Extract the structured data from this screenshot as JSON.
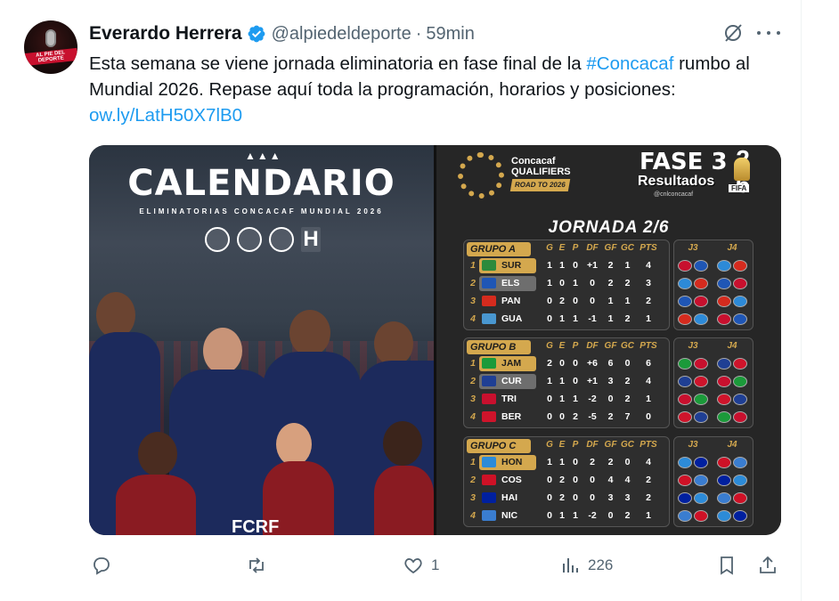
{
  "author": {
    "name": "Everardo Herrera",
    "handle": "@alpiedeldeporte",
    "separator": "·",
    "time": "59min",
    "avatar_text": "AL PIE DEL DEPORTE"
  },
  "tweet": {
    "text_before": "Esta semana se viene jornada eliminatoria en fase final de la ",
    "hashtag": "#Concacaf",
    "text_after": " rumbo al Mundial 2026. Repase aquí toda la programación, horarios y posiciones: ",
    "link": "ow.ly/LatH50X7lB0"
  },
  "left_image": {
    "title": "CALENDARIO",
    "subtitle": "ELIMINATORIAS CONCACAF MUNDIAL 2026",
    "crest_h": "H",
    "footer": "FCRF"
  },
  "right_image": {
    "concacaf": "Concacaf",
    "qualifiers": "QUALIFIERS",
    "road": "ROAD TO 2026",
    "fase": "FASE 3",
    "resultados": "Resultados",
    "handle": "@cnlconcacaf",
    "big_top": "2",
    "big_bottom": "6",
    "fifa": "FIFA",
    "jornada": "JORNADA 2/6",
    "headers": [
      "G",
      "E",
      "P",
      "DF",
      "GF",
      "GC",
      "PTS"
    ],
    "j3": "J3",
    "j4": "J4",
    "groups": [
      {
        "title": "GRUPO A",
        "rows": [
          {
            "pos": "1",
            "team": "SUR",
            "style": "gold",
            "flag": "#2c8a3c",
            "stats": [
              "1",
              "1",
              "0",
              "+1",
              "2",
              "1",
              "4"
            ]
          },
          {
            "pos": "2",
            "team": "ELS",
            "style": "gray",
            "flag": "#1f56b5",
            "stats": [
              "1",
              "0",
              "1",
              "0",
              "2",
              "2",
              "3"
            ]
          },
          {
            "pos": "3",
            "team": "PAN",
            "style": "",
            "flag": "#d52b1e",
            "stats": [
              "0",
              "2",
              "0",
              "0",
              "1",
              "1",
              "2"
            ]
          },
          {
            "pos": "4",
            "team": "GUA",
            "style": "",
            "flag": "#4997d0",
            "stats": [
              "0",
              "1",
              "1",
              "-1",
              "1",
              "2",
              "1"
            ]
          }
        ]
      },
      {
        "title": "GRUPO B",
        "rows": [
          {
            "pos": "1",
            "team": "JAM",
            "style": "gold",
            "flag": "#1b9a3a",
            "stats": [
              "2",
              "0",
              "0",
              "+6",
              "6",
              "0",
              "6"
            ]
          },
          {
            "pos": "2",
            "team": "CUR",
            "style": "gray",
            "flag": "#1f3f94",
            "stats": [
              "1",
              "1",
              "0",
              "+1",
              "3",
              "2",
              "4"
            ]
          },
          {
            "pos": "3",
            "team": "TRI",
            "style": "",
            "flag": "#c8102e",
            "stats": [
              "0",
              "1",
              "1",
              "-2",
              "0",
              "2",
              "1"
            ]
          },
          {
            "pos": "4",
            "team": "BER",
            "style": "",
            "flag": "#cf142b",
            "stats": [
              "0",
              "0",
              "2",
              "-5",
              "2",
              "7",
              "0"
            ]
          }
        ]
      },
      {
        "title": "GRUPO C",
        "rows": [
          {
            "pos": "1",
            "team": "HON",
            "style": "gold",
            "flag": "#2c8bd8",
            "stats": [
              "1",
              "1",
              "0",
              "2",
              "2",
              "0",
              "4"
            ]
          },
          {
            "pos": "2",
            "team": "COS",
            "style": "",
            "flag": "#ce1126",
            "stats": [
              "0",
              "2",
              "0",
              "0",
              "4",
              "4",
              "2"
            ]
          },
          {
            "pos": "3",
            "team": "HAI",
            "style": "",
            "flag": "#00209f",
            "stats": [
              "0",
              "2",
              "0",
              "0",
              "3",
              "3",
              "2"
            ]
          },
          {
            "pos": "4",
            "team": "NIC",
            "style": "",
            "flag": "#3a7dd0",
            "stats": [
              "0",
              "1",
              "1",
              "-2",
              "0",
              "2",
              "1"
            ]
          }
        ]
      }
    ]
  },
  "actions": {
    "reply_count": "",
    "retweet_count": "",
    "like_count": "1",
    "views_count": "226"
  },
  "colors": {
    "link": "#1d9bf0",
    "muted": "#536471",
    "gold": "#d4a84e"
  }
}
